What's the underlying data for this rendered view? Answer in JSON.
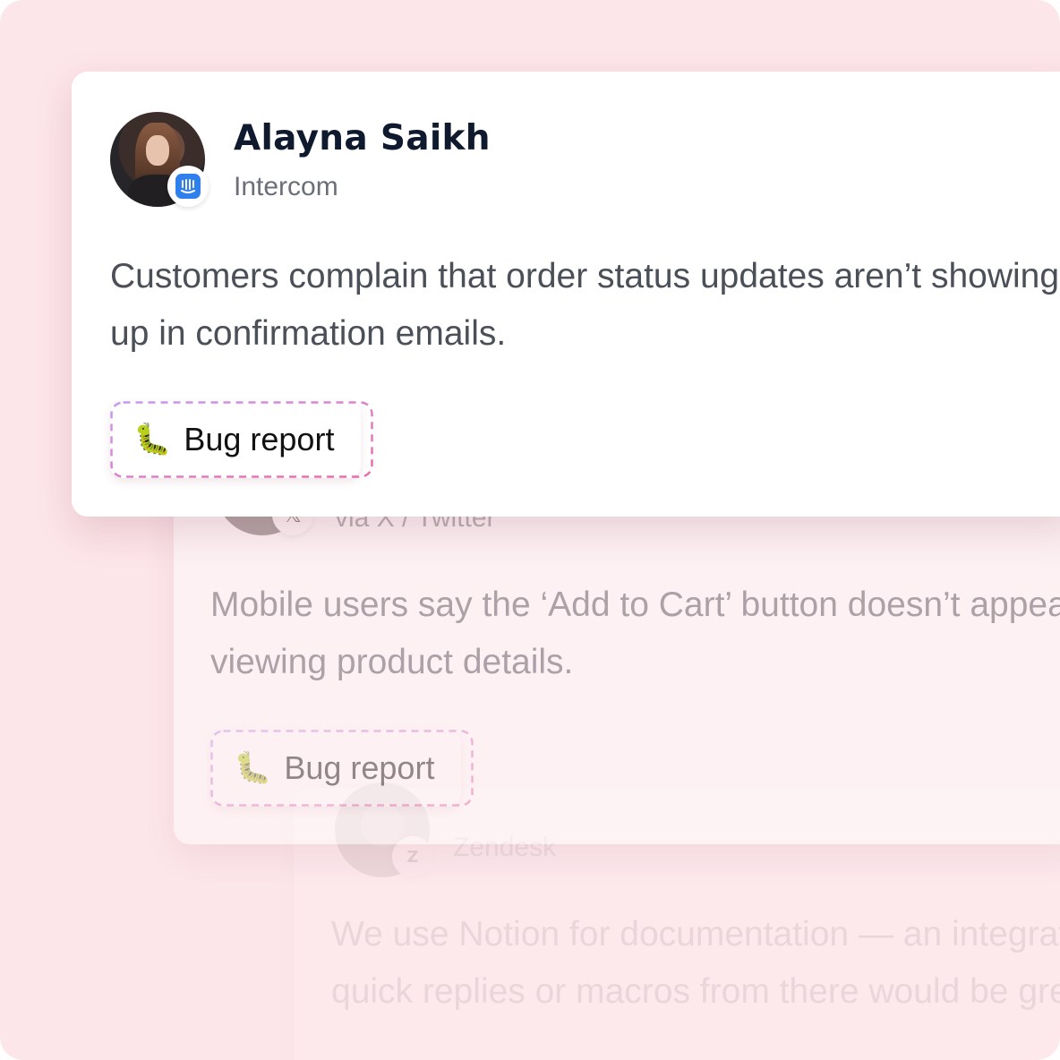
{
  "cards": [
    {
      "name": "Alayna Saikh",
      "source": "Intercom",
      "source_icon": "intercom-icon",
      "message_lines": [
        "Customers complain that order status updates aren’t showing",
        "up in confirmation emails."
      ],
      "tag": {
        "emoji": "🐛",
        "label": "Bug report"
      }
    },
    {
      "source": "via X / Twitter",
      "source_icon": "x-icon",
      "message_lines": [
        "Mobile users say the ‘Add to Cart’ button doesn’t appear when",
        "viewing product details."
      ],
      "tag": {
        "emoji": "🐛",
        "label": "Bug report"
      }
    },
    {
      "source": "Zendesk",
      "source_icon": "zendesk-icon",
      "message_lines": [
        "We use Notion for documentation — an integration to pull",
        "quick replies or macros from there would be great."
      ]
    }
  ],
  "colors": {
    "background": "#fde6ea",
    "card": "#ffffff",
    "name": "#0f1a2e",
    "intercom_blue": "#2f80ed",
    "tag_border_start": "#c59bf0",
    "tag_border_end": "#f06aa8"
  }
}
